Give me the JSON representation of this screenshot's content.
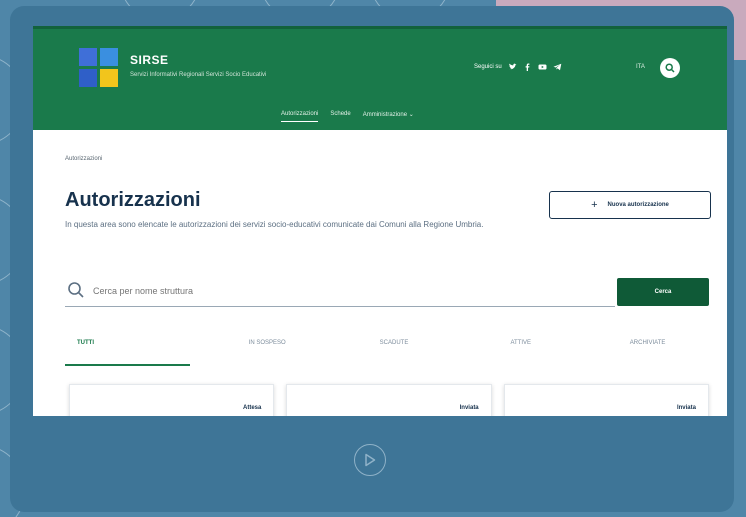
{
  "app": {
    "name": "SIRSE",
    "subtitle": "Servizi Informativi Regionali Servizi Socio Educativi"
  },
  "header": {
    "social_label": "Seguici su",
    "social_icons": [
      "twitter-icon",
      "facebook-icon",
      "youtube-icon",
      "telegram-icon"
    ],
    "lang": "ITA",
    "nav": [
      {
        "label": "Autorizzazioni",
        "active": true
      },
      {
        "label": "Schede",
        "active": false
      },
      {
        "label": "Amministrazione ⌄",
        "active": false
      }
    ]
  },
  "breadcrumb": "Autorizzazioni",
  "page": {
    "title": "Autorizzazioni",
    "description": "In questa area sono elencate le autorizzazioni dei servizi socio-educativi comunicate dai Comuni alla Regione Umbria.",
    "new_button_label": "Nuova autorizzazione",
    "new_button_icon": "+"
  },
  "search": {
    "placeholder": "Cerca per nome struttura",
    "button_label": "Cerca"
  },
  "tabs": [
    {
      "label": "TUTTI",
      "active": true
    },
    {
      "label": "IN SOSPESO",
      "active": false
    },
    {
      "label": "SCADUTE",
      "active": false
    },
    {
      "label": "ATTIVE",
      "active": false
    },
    {
      "label": "ARCHIVIATE",
      "active": false
    }
  ],
  "cards": [
    {
      "badge": "Attesa"
    },
    {
      "badge": "Inviata"
    },
    {
      "badge": "Inviata"
    }
  ],
  "colors": {
    "header_green": "#1a7a4b",
    "button_green": "#0f5a37",
    "title_navy": "#17324d",
    "frame_blue": "#3e7597"
  }
}
